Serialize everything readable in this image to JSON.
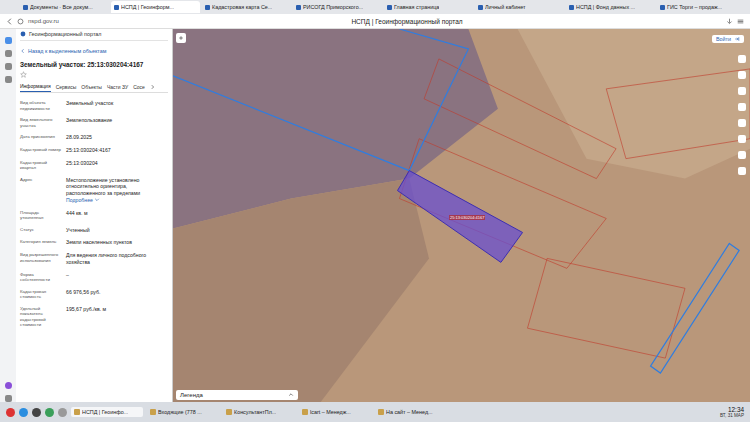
{
  "browser": {
    "tabs": [
      {
        "label": "Документы · Все докум...",
        "selected": false
      },
      {
        "label": "НСПД | Геоинформ...",
        "selected": true
      },
      {
        "label": "Кадастровая карта Се...",
        "selected": false
      },
      {
        "label": "РИСОГД Приморского...",
        "selected": false
      },
      {
        "label": "Главная страница",
        "selected": false
      },
      {
        "label": "Личный кабинет",
        "selected": false
      },
      {
        "label": "НСПД | Фонд данных ...",
        "selected": false
      },
      {
        "label": "ГИС Торги – продаж...",
        "selected": false
      }
    ],
    "address": "nspd.gov.ru",
    "page_title": "НСПД | Геоинформационный портал"
  },
  "panel": {
    "portal": "Геоинформационный портал",
    "back": "Назад к выделенным объектам",
    "title": "Земельный участок: 25:13:030204:4167",
    "more": "Подробнее",
    "tabs": [
      {
        "label": "Информация",
        "selected": true
      },
      {
        "label": "Сервисы",
        "selected": false
      },
      {
        "label": "Объекты",
        "selected": false
      },
      {
        "label": "Части ЗУ",
        "selected": false
      },
      {
        "label": "Сосе",
        "selected": false
      }
    ],
    "fields": [
      {
        "label": "Вид объекта недвижимости",
        "value": "Земельный участок",
        "kind": "text"
      },
      {
        "label": "Вид земельного участка",
        "value": "Землепользование",
        "kind": "text"
      },
      {
        "label": "Дата присвоения",
        "value": "28.09.2025",
        "kind": "text"
      },
      {
        "label": "Кадастровый номер",
        "value": "25:13:030204:4167",
        "kind": "text"
      },
      {
        "label": "Кадастровый квартал",
        "value": "25:13:030204",
        "kind": "text"
      },
      {
        "label": "Адрес",
        "value": "Местоположение установлено относительно ориентира, расположенного за пределами",
        "kind": "address"
      },
      {
        "label": "Площадь уточненная",
        "value": "444 кв. м",
        "kind": "text"
      },
      {
        "label": "Статус",
        "value": "Учтенный",
        "kind": "text"
      },
      {
        "label": "Категория земель",
        "value": "Земли населенных пунктов",
        "kind": "text"
      },
      {
        "label": "Вид разрешенного использования",
        "value": "Для ведения личного подсобного хозяйства",
        "kind": "text"
      },
      {
        "label": "Форма собственности",
        "value": "–",
        "kind": "text"
      },
      {
        "label": "Кадастровая стоимость",
        "value": "66 976,56 руб.",
        "kind": "text"
      },
      {
        "label": "Удельный показатель кадастровой стоимости",
        "value": "195,67 руб./кв. м",
        "kind": "text"
      }
    ]
  },
  "map": {
    "login": "Войти",
    "legend": "Легенда",
    "selected_parcel": "25:13:030204:4167"
  },
  "taskbar": {
    "items": [
      {
        "label": "НСПД | Геоинфо...",
        "selected": true
      },
      {
        "label": "Входящие (778 ...",
        "selected": false
      },
      {
        "label": "КонсультантПл...",
        "selected": false
      },
      {
        "label": "lcart – Менедж...",
        "selected": false
      },
      {
        "label": "На сайт – Менед...",
        "selected": false
      }
    ],
    "time": "12:34",
    "date": "ВТ, 31 МАР"
  }
}
